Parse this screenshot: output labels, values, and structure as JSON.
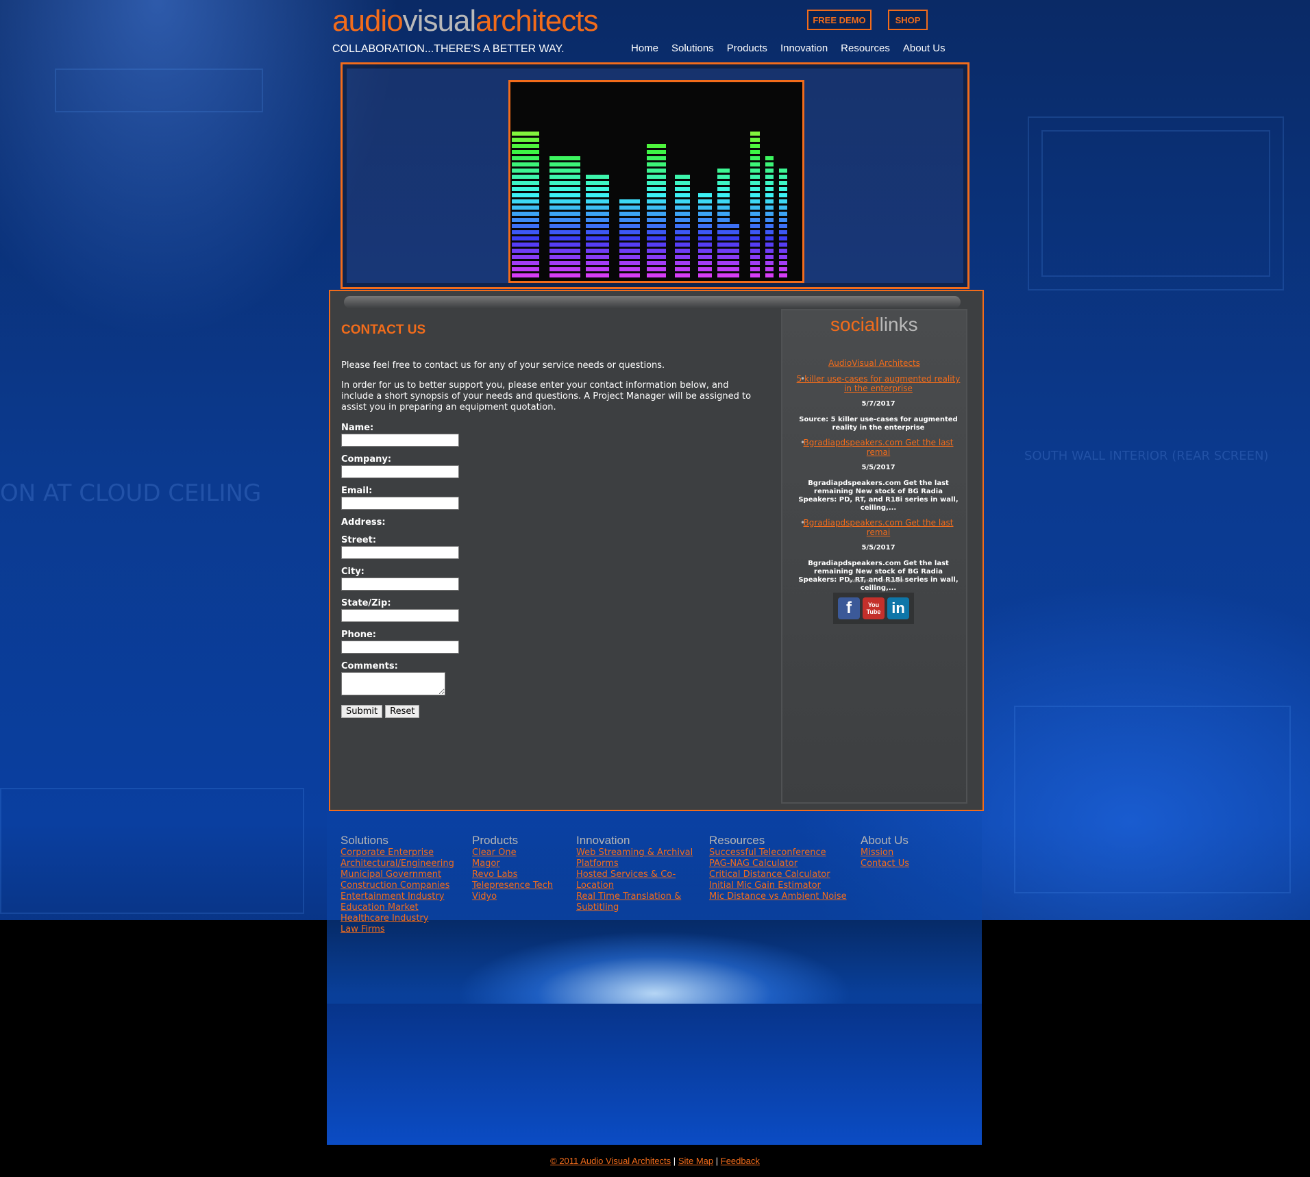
{
  "brand": {
    "logo_a": "audio",
    "logo_b": "visual",
    "logo_c": "architects",
    "tagline": "COLLABORATION...THERE'S A BETTER WAY."
  },
  "top_buttons": {
    "free_demo": "FREE DEMO",
    "shop": "SHOP"
  },
  "nav": [
    "Home",
    "Solutions",
    "Products",
    "Innovation",
    "Resources",
    "About Us"
  ],
  "contact": {
    "heading": "CONTACT US",
    "intro": "Please feel free to contact us for any of your service needs or questions.",
    "instructions": "In order for us to better support you, please enter your contact information below, and include a short synopsis of your needs and questions. A Project Manager will be assigned to assist you in preparing an equipment quotation.",
    "labels": {
      "name": "Name:",
      "company": "Company:",
      "email": "Email:",
      "address": "Address:",
      "street": "Street:",
      "city": "City:",
      "state_zip": "State/Zip:",
      "phone": "Phone:",
      "comments": "Comments:"
    },
    "submit": "Submit",
    "reset": "Reset"
  },
  "social": {
    "title_a": "social",
    "title_b": "links",
    "feed_title": "AudioVisual Architects",
    "items": [
      {
        "link": "5 killer use-cases for augmented reality in the enterprise",
        "date": "5/7/2017",
        "summary": "Source: 5 killer use-cases for augmented reality in the enterprise"
      },
      {
        "link": "Bgradiapdspeakers.com Get the last remai",
        "date": "5/5/2017",
        "summary": "Bgradiapdspeakers.com Get the last remaining New stock of BG Radia Speakers: PD, RT, and R18i series in wall, ceiling,..."
      },
      {
        "link": "Bgradiapdspeakers.com Get the last remai",
        "date": "5/5/2017",
        "summary": "Bgradiapdspeakers.com Get the last remaining New stock of BG Radia Speakers: PD, RT, and R18i series in wall, ceiling,..."
      }
    ],
    "feedburner_note": "HEADLINES BY FEEDBURNER",
    "icon_fb": "f",
    "icon_yt": "You Tube",
    "icon_in": "in"
  },
  "footer": {
    "solutions": {
      "head": "Solutions",
      "links": [
        "Corporate Enterprise",
        "Architectural/Engineering",
        "Municipal Government",
        "Construction Companies",
        "Entertainment Industry",
        "Education Market",
        "Healthcare Industry",
        "Law Firms"
      ]
    },
    "products": {
      "head": "Products",
      "links": [
        "Clear One",
        "Magor",
        "Revo Labs",
        "Telepresence Tech",
        "Vidyo"
      ]
    },
    "innovation": {
      "head": "Innovation",
      "links": [
        "Web Streaming & Archival Platforms",
        "Hosted Services & Co-Location",
        "Real Time Translation & Subtitling"
      ]
    },
    "resources": {
      "head": "Resources",
      "links": [
        "Successful Teleconference",
        "PAG-NAG Calculator",
        "Critical Distance Calculator",
        "Initial Mic Gain Estimator",
        "Mic Distance vs Ambient Noise"
      ]
    },
    "about": {
      "head": "About Us",
      "links": [
        "Mission",
        "Contact Us"
      ]
    }
  },
  "copyright": {
    "copy": "© 2011 Audio Visual Architects",
    "sitemap": "Site Map",
    "feedback": "Feedback",
    "sep": "|"
  },
  "blueprint_labels": {
    "cloud": "ON AT CLOUD CEILING",
    "south": "SOUTH WALL INTERIOR (REAR SCREEN)"
  },
  "colors": {
    "accent": "#f26c1b",
    "panel": "#3d3f41",
    "grey_text": "#b9b9b9"
  }
}
